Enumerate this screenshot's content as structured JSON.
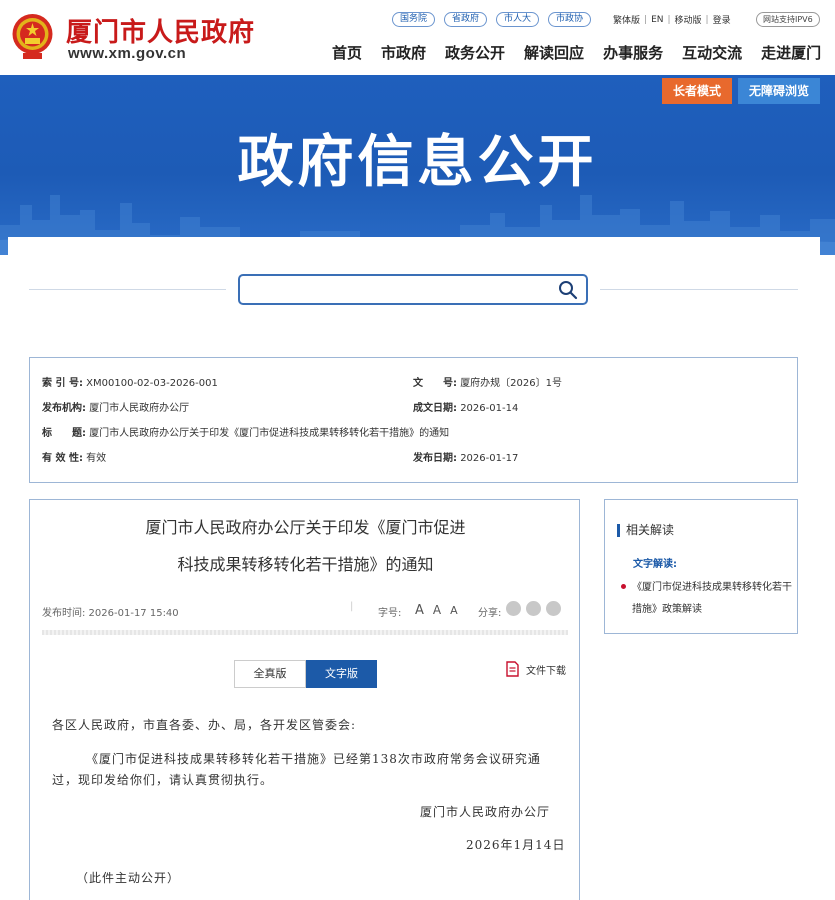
{
  "header": {
    "site_name": "厦门市人民政府",
    "site_url": "www.xm.gov.cn",
    "gov_links": [
      "国务院",
      "省政府",
      "市人大",
      "市政协"
    ],
    "util_links": [
      "繁体版",
      "EN",
      "移动版",
      "登录"
    ],
    "ipv6": "网站支持IPV6",
    "nav": [
      "首页",
      "市政府",
      "政务公开",
      "解读回应",
      "办事服务",
      "互动交流",
      "走进厦门"
    ]
  },
  "banner": {
    "title": "政府信息公开",
    "elder_mode": "长者模式",
    "accessible": "无障碍浏览"
  },
  "search": {
    "placeholder": ""
  },
  "meta": {
    "index_label": "索 引 号:",
    "index_value": "XM00100-02-03-2026-001",
    "doc_no_label": "文　　号:",
    "doc_no_value": "厦府办规〔2026〕1号",
    "org_label": "发布机构:",
    "org_value": "厦门市人民政府办公厅",
    "date_made_label": "成文日期:",
    "date_made_value": "2026-01-14",
    "title_label": "标　　题:",
    "title_value": "厦门市人民政府办公厅关于印发《厦门市促进科技成果转移转化若干措施》的通知",
    "valid_label": "有 效 性:",
    "valid_value": "有效",
    "pub_date_label": "发布日期:",
    "pub_date_value": "2026-01-17"
  },
  "article": {
    "title_line1": "厦门市人民政府办公厅关于印发《厦门市促进",
    "title_line2": "科技成果转移转化若干措施》的通知",
    "publish_time": "发布时间: 2026-01-17 15:40",
    "font_size_label": "字号:",
    "share_label": "分享:",
    "font_a": [
      "A",
      "A",
      "A"
    ],
    "tab_full": "全真版",
    "tab_text": "文字版",
    "download": "文件下载",
    "salutation": "各区人民政府，市直各委、办、局，各开发区管委会:",
    "para1_line1": "《厦门市促进科技成果转移转化若干措施》已经第138次市政府常务会议研究通",
    "para1_line2": "过，现印发给你们，请认真贯彻执行。",
    "signer": "厦门市人民政府办公厅",
    "date": "2026年1月14日",
    "note": "（此件主动公开）"
  },
  "related": {
    "heading": "相关解读",
    "sub": "文字解读:",
    "link": "《厦门市促进科技成果转移转化若干措施》政策解读"
  },
  "colors": {
    "brand_red": "#c81a1a",
    "banner_blue": "#1f5fbd",
    "nav_blue": "#1c5aa8",
    "elder_orange": "#e8692d",
    "access_blue": "#3b86d6"
  },
  "icons": [
    "national-emblem-icon",
    "search-icon",
    "file-download-icon",
    "wechat-icon",
    "weibo-icon",
    "share-icon"
  ]
}
